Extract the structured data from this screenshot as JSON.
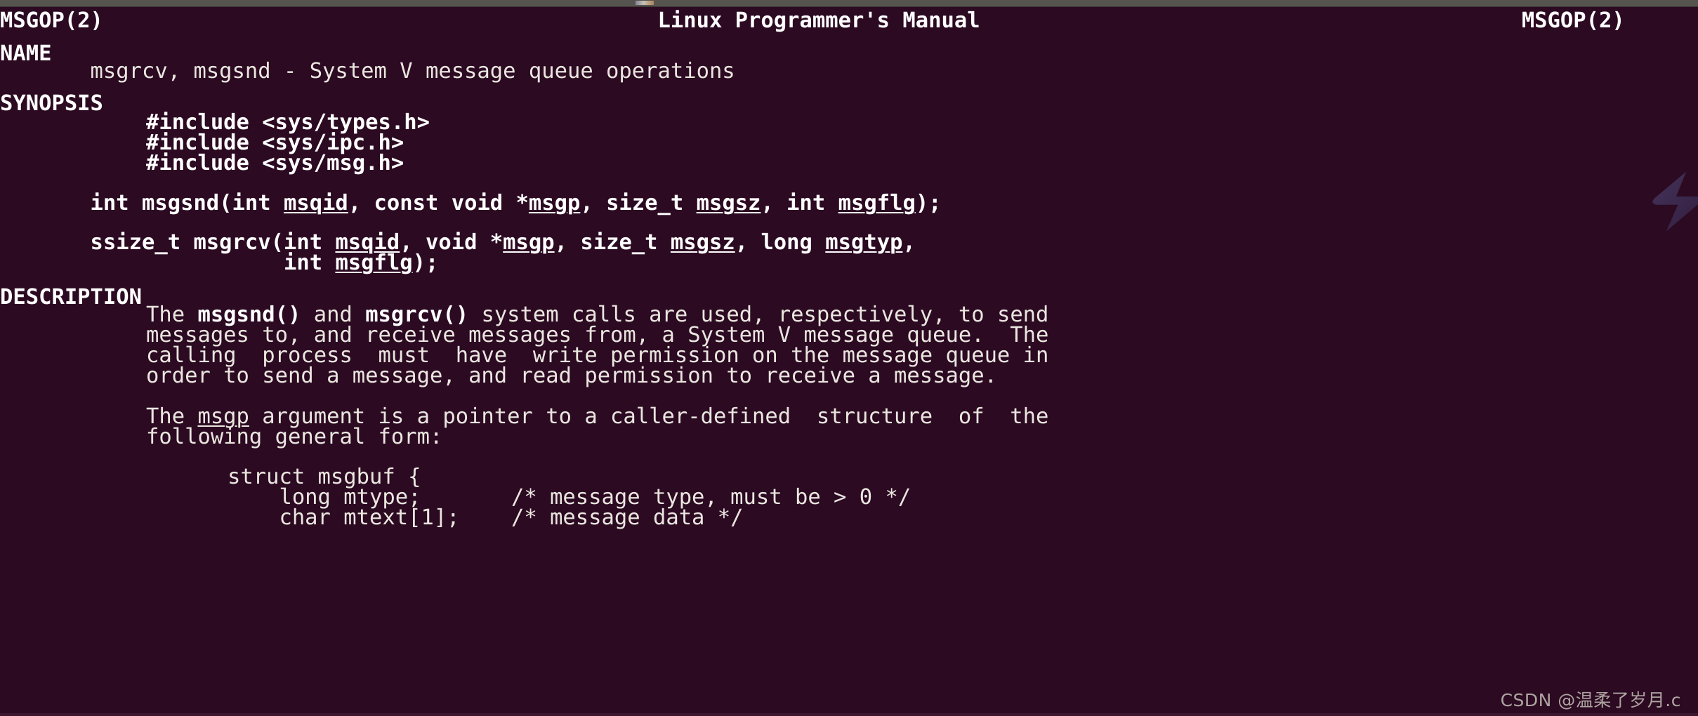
{
  "window": {
    "titlebar_color": "#56544e",
    "background_color": "#2c0a22",
    "foreground_color": "#eae6df"
  },
  "manpage": {
    "header": {
      "left": "MSGOP(2)",
      "center": "Linux Programmer's Manual",
      "right": "MSGOP(2)"
    },
    "sections": [
      {
        "name": "NAME",
        "heading": "NAME",
        "lines": [
          "       msgrcv, msgsnd - System V message queue operations"
        ]
      },
      {
        "name": "SYNOPSIS",
        "heading": "SYNOPSIS",
        "includes": [
          "#include <sys/types.h>",
          "#include <sys/ipc.h>",
          "#include <sys/msg.h>"
        ],
        "prototypes": [
          {
            "return_type": "int",
            "function": "msgsnd",
            "text_parts": [
              {
                "t": "       int msgsnd(int ",
                "style": "bold"
              },
              {
                "t": "msqid",
                "style": "bold-underline"
              },
              {
                "t": ", const void *",
                "style": "bold"
              },
              {
                "t": "msgp",
                "style": "bold-underline"
              },
              {
                "t": ", size_t ",
                "style": "bold"
              },
              {
                "t": "msgsz",
                "style": "bold-underline"
              },
              {
                "t": ", int ",
                "style": "bold"
              },
              {
                "t": "msgflg",
                "style": "bold-underline"
              },
              {
                "t": ");",
                "style": "bold"
              }
            ]
          },
          {
            "return_type": "ssize_t",
            "function": "msgrcv",
            "text_parts": [
              {
                "t": "       ssize_t msgrcv(int ",
                "style": "bold"
              },
              {
                "t": "msqid",
                "style": "bold-underline"
              },
              {
                "t": ", void *",
                "style": "bold"
              },
              {
                "t": "msgp",
                "style": "bold-underline"
              },
              {
                "t": ", size_t ",
                "style": "bold"
              },
              {
                "t": "msgsz",
                "style": "bold-underline"
              },
              {
                "t": ", long ",
                "style": "bold"
              },
              {
                "t": "msgtyp",
                "style": "bold-underline"
              },
              {
                "t": ",",
                "style": "bold"
              }
            ]
          },
          {
            "return_type": "",
            "function": "msgrcv-cont",
            "text_parts": [
              {
                "t": "                      int ",
                "style": "bold"
              },
              {
                "t": "msgflg",
                "style": "bold-underline"
              },
              {
                "t": ");",
                "style": "bold"
              }
            ]
          }
        ]
      },
      {
        "name": "DESCRIPTION",
        "heading": "DESCRIPTION",
        "paragraph_1": [
          "The msgsnd() and msgrcv() system calls are used, respectively, to send",
          "messages to, and receive messages from, a System V message queue.  The",
          "calling  process  must  have  write permission on the message queue in",
          "order to send a message, and read permission to receive a message."
        ],
        "paragraph_2": [
          "The msgp argument is a pointer to a caller-defined  structure  of  the",
          "following general form:"
        ],
        "code_block": [
          "struct msgbuf {",
          "    long mtype;       /* message type, must be > 0 */",
          "    char mtext[1];    /* message data */"
        ]
      }
    ]
  },
  "watermarks": {
    "csdn": "CSDN @温柔了岁月.c",
    "logo_name": "lightning-bolt-logo"
  }
}
